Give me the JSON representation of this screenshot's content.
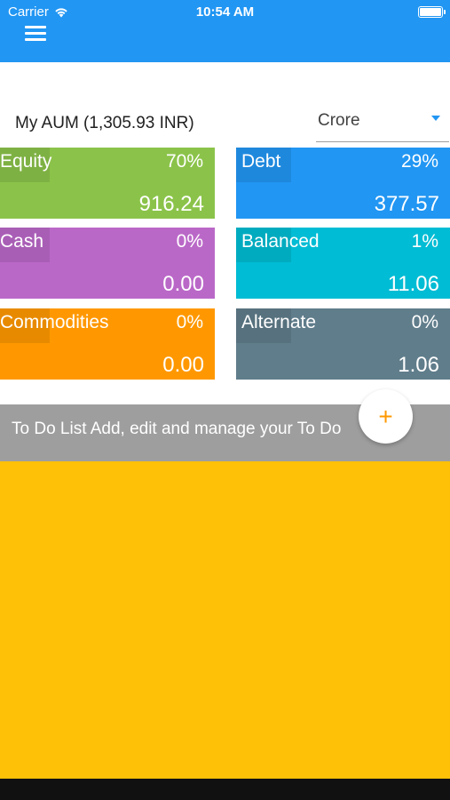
{
  "status_bar": {
    "carrier": "Carrier",
    "time": "10:54 AM"
  },
  "header": {
    "menu_icon": "hamburger-menu-icon",
    "color": "#2196F3"
  },
  "aum": {
    "title": "My AUM (1,305.93 INR)",
    "unit_selected": "Crore"
  },
  "asset_tiles": [
    {
      "name": "Equity",
      "percent": "70%",
      "amount": "916.24",
      "color": "#8BC34A"
    },
    {
      "name": "Debt",
      "percent": "29%",
      "amount": "377.57",
      "color": "#2196F3"
    },
    {
      "name": "Cash",
      "percent": "0%",
      "amount": "0.00",
      "color": "#BA68C8"
    },
    {
      "name": "Balanced",
      "percent": "1%",
      "amount": "11.06",
      "color": "#00BCD4"
    },
    {
      "name": "Commodities",
      "percent": "0%",
      "amount": "0.00",
      "color": "#FF9800"
    },
    {
      "name": "Alternate",
      "percent": "0%",
      "amount": "1.06",
      "color": "#607D8B"
    }
  ],
  "todo": {
    "text": "To Do List Add, edit and manage your To Do",
    "fab_symbol": "+"
  },
  "panel_color": "#FFC107"
}
